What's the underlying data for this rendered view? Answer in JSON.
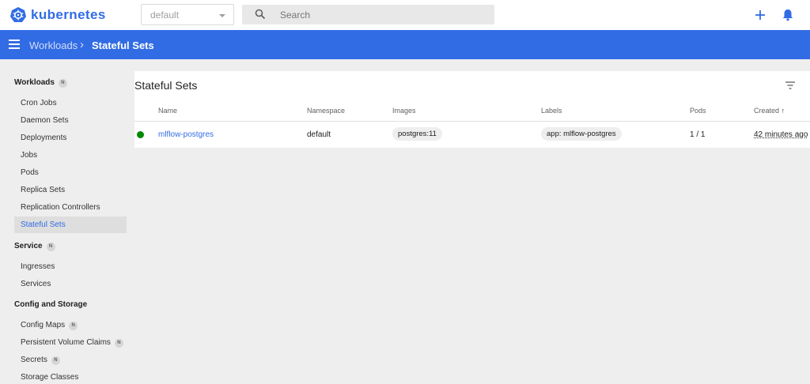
{
  "topbar": {
    "brand": "kubernetes",
    "namespace_value": "default",
    "search_placeholder": "Search",
    "accent_color": "#326ce5"
  },
  "header": {
    "breadcrumb_parent": "Workloads",
    "breadcrumb_separator": "›",
    "breadcrumb_current": "Stateful Sets"
  },
  "sidebar": {
    "workloads": {
      "title": "Workloads",
      "badge": "N",
      "items": [
        "Cron Jobs",
        "Daemon Sets",
        "Deployments",
        "Jobs",
        "Pods",
        "Replica Sets",
        "Replication Controllers",
        "Stateful Sets"
      ],
      "active": "Stateful Sets"
    },
    "service": {
      "title": "Service",
      "badge": "N",
      "items": [
        "Ingresses",
        "Services"
      ]
    },
    "config": {
      "title": "Config and Storage",
      "items": [
        {
          "label": "Config Maps",
          "badge": "N"
        },
        {
          "label": "Persistent Volume Claims",
          "badge": "N"
        },
        {
          "label": "Secrets",
          "badge": "N"
        },
        {
          "label": "Storage Classes",
          "badge": ""
        }
      ]
    }
  },
  "card": {
    "title": "Stateful Sets",
    "columns": [
      "Name",
      "Namespace",
      "Images",
      "Labels",
      "Pods",
      "Created"
    ],
    "sort_indicator": "↑",
    "rows": [
      {
        "status": "running",
        "status_color": "#008a00",
        "name": "mlflow-postgres",
        "namespace": "default",
        "image": "postgres:11",
        "label": "app: mlflow-postgres",
        "pods": "1 / 1",
        "created": "42 minutes ago"
      }
    ]
  }
}
